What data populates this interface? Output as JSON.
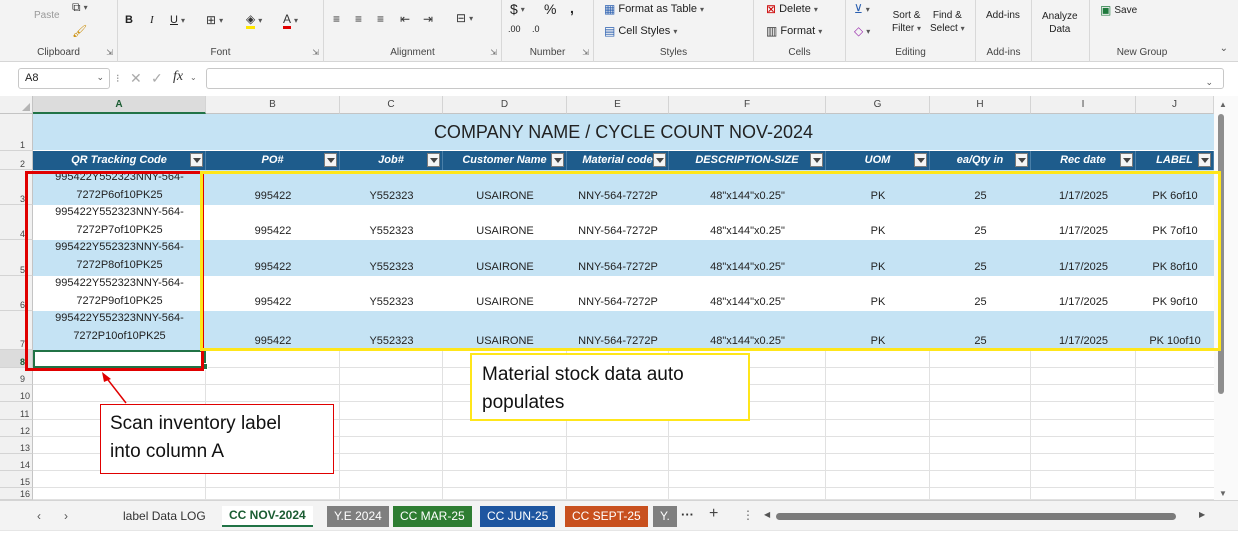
{
  "ribbon": {
    "clipboard": {
      "label": "Clipboard",
      "paste": "Paste"
    },
    "font": {
      "label": "Font",
      "bold": "B",
      "italic": "I",
      "underline": "U"
    },
    "alignment": {
      "label": "Alignment"
    },
    "number": {
      "label": "Number",
      "currency": "$",
      "percent": "%",
      "comma": ",",
      "inc_decimal": ".00",
      "dec_decimal": ".0"
    },
    "styles": {
      "label": "Styles",
      "format_as_table": "Format as Table",
      "cell_styles": "Cell Styles"
    },
    "cells": {
      "label": "Cells",
      "delete": "Delete",
      "format": "Format"
    },
    "editing": {
      "label": "Editing",
      "sort_filter_l1": "Sort &",
      "sort_filter_l2": "Filter",
      "find_select_l1": "Find &",
      "find_select_l2": "Select"
    },
    "addins": {
      "label": "Add-ins",
      "addins_btn": "Add-ins"
    },
    "analyze": {
      "l1": "Analyze",
      "l2": "Data"
    },
    "newgroup": {
      "label": "New Group",
      "save": "Save"
    }
  },
  "formula_bar": {
    "name_box": "A8",
    "fx": "fx",
    "formula": ""
  },
  "columns": [
    "A",
    "B",
    "C",
    "D",
    "E",
    "F",
    "G",
    "H",
    "I",
    "J"
  ],
  "rows": [
    "1",
    "2",
    "3",
    "4",
    "5",
    "6",
    "7",
    "8",
    "9",
    "10",
    "11",
    "12",
    "13",
    "14",
    "15",
    "16"
  ],
  "sheet": {
    "title": "COMPANY NAME / CYCLE COUNT NOV-2024",
    "headers": [
      "QR Tracking Code",
      "PO#",
      "Job#",
      "Customer Name",
      "Material code",
      "DESCRIPTION-SIZE",
      "UOM",
      "ea/Qty in",
      "Rec date",
      "LABEL"
    ],
    "data": [
      {
        "qr1": "995422Y552323NNY-564-",
        "qr2": "7272P6of10PK25",
        "po": "995422",
        "job": "Y552323",
        "customer": "USAIRONE",
        "material": "NNY-564-7272P",
        "desc": "48\"x144\"x0.25\"",
        "uom": "PK",
        "qty": "25",
        "rec": "1/17/2025",
        "label": "PK 6of10"
      },
      {
        "qr1": "995422Y552323NNY-564-",
        "qr2": "7272P7of10PK25",
        "po": "995422",
        "job": "Y552323",
        "customer": "USAIRONE",
        "material": "NNY-564-7272P",
        "desc": "48\"x144\"x0.25\"",
        "uom": "PK",
        "qty": "25",
        "rec": "1/17/2025",
        "label": "PK 7of10"
      },
      {
        "qr1": "995422Y552323NNY-564-",
        "qr2": "7272P8of10PK25",
        "po": "995422",
        "job": "Y552323",
        "customer": "USAIRONE",
        "material": "NNY-564-7272P",
        "desc": "48\"x144\"x0.25\"",
        "uom": "PK",
        "qty": "25",
        "rec": "1/17/2025",
        "label": "PK 8of10"
      },
      {
        "qr1": "995422Y552323NNY-564-",
        "qr2": "7272P9of10PK25",
        "po": "995422",
        "job": "Y552323",
        "customer": "USAIRONE",
        "material": "NNY-564-7272P",
        "desc": "48\"x144\"x0.25\"",
        "uom": "PK",
        "qty": "25",
        "rec": "1/17/2025",
        "label": "PK 9of10"
      },
      {
        "qr1": "995422Y552323NNY-564-",
        "qr2": "7272P10of10PK25",
        "po": "995422",
        "job": "Y552323",
        "customer": "USAIRONE",
        "material": "NNY-564-7272P",
        "desc": "48\"x144\"x0.25\"",
        "uom": "PK",
        "qty": "25",
        "rec": "1/17/2025",
        "label": "PK 10of10"
      }
    ]
  },
  "annotations": {
    "scan_line1": "Scan inventory label",
    "scan_line2": "into column A",
    "auto_line1": "Material stock data auto",
    "auto_line2": "populates"
  },
  "tabs": [
    {
      "label": "label Data LOG",
      "color": "",
      "active": false
    },
    {
      "label": "CC NOV-2024",
      "color": "",
      "active": true
    },
    {
      "label": "Y.E 2024",
      "color": "#7f7f7f",
      "active": false
    },
    {
      "label": "CC MAR-25",
      "color": "#2e7d32",
      "active": false
    },
    {
      "label": "CC JUN-25",
      "color": "#1e56a0",
      "active": false
    },
    {
      "label": "CC SEPT-25",
      "color": "#c8501e",
      "active": false
    },
    {
      "label": "Y.",
      "color": "#7f7f7f",
      "active": false
    }
  ],
  "colors": {
    "title_band": "#c5e3f4",
    "header_band": "#1e5c8c",
    "band_light": "#c5e3f4",
    "band_white": "#ffffff",
    "red_annotation": "#e00000",
    "yellow_annotation": "#ffe61a",
    "excel_green": "#217346"
  },
  "icons": [
    "copy-icon",
    "format-painter-icon",
    "borders-icon",
    "fill-color-icon",
    "font-color-icon",
    "align-left-icon",
    "align-center-icon",
    "align-right-icon",
    "indent-decrease-icon",
    "indent-increase-icon",
    "merge-icon",
    "format-as-table-icon",
    "cell-styles-icon",
    "delete-cells-icon",
    "format-cells-icon",
    "autosum-icon",
    "clear-icon",
    "save-icon",
    "filter-dropdown-icon"
  ]
}
